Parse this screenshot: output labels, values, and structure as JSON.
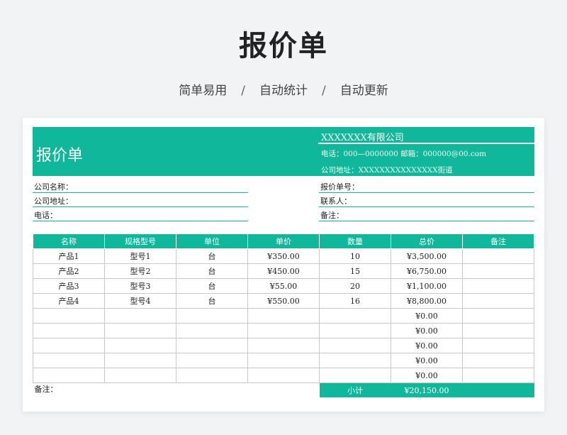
{
  "page": {
    "title": "报价单",
    "subtitle": [
      "简单易用",
      "自动统计",
      "自动更新"
    ],
    "separator": "/"
  },
  "header": {
    "title": "报价单",
    "company": "XXXXXXX有限公司",
    "contact": "电话：000—0000000 邮箱：000000@00.com",
    "address": "公司地址：XXXXXXXXXXXXXXX街道",
    "accent_color": "#10b79a"
  },
  "info": {
    "left": [
      "公司名称：",
      "公司地址：",
      "电话："
    ],
    "right": [
      "报价单号：",
      "联系人：",
      "备注："
    ]
  },
  "table": {
    "columns": [
      "名称",
      "规格型号",
      "单位",
      "单价",
      "数量",
      "总价",
      "备注"
    ],
    "rows": [
      [
        "产品1",
        "型号1",
        "台",
        "¥350.00",
        "10",
        "¥3,500.00",
        ""
      ],
      [
        "产品2",
        "型号2",
        "台",
        "¥450.00",
        "15",
        "¥6,750.00",
        ""
      ],
      [
        "产品3",
        "型号3",
        "台",
        "¥55.00",
        "20",
        "¥1,100.00",
        ""
      ],
      [
        "产品4",
        "型号4",
        "台",
        "¥550.00",
        "16",
        "¥8,800.00",
        ""
      ],
      [
        "",
        "",
        "",
        "",
        "",
        "¥0.00",
        ""
      ],
      [
        "",
        "",
        "",
        "",
        "",
        "¥0.00",
        ""
      ],
      [
        "",
        "",
        "",
        "",
        "",
        "¥0.00",
        ""
      ],
      [
        "",
        "",
        "",
        "",
        "",
        "¥0.00",
        ""
      ],
      [
        "",
        "",
        "",
        "",
        "",
        "¥0.00",
        ""
      ]
    ],
    "footer": {
      "note_label": "备注：",
      "subtotal_label": "小计",
      "subtotal_value": "¥20,150.00"
    }
  }
}
